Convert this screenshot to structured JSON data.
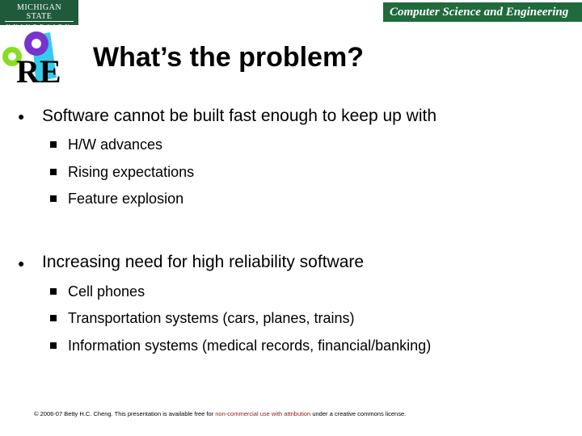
{
  "header": {
    "msu_line1": "MICHIGAN STATE",
    "msu_line2": "UNIVERSITY",
    "department": "Computer Science and Engineering"
  },
  "title": "What’s the problem?",
  "bullets": [
    {
      "text": "Software cannot be built fast enough to keep up with",
      "sub": [
        "H/W advances",
        "Rising expectations",
        "Feature explosion"
      ]
    },
    {
      "text": "Increasing need for high reliability software",
      "sub": [
        "Cell phones",
        "Transportation systems (cars, planes, trains)",
        "Information systems (medical records, financial/banking)"
      ]
    }
  ],
  "footer": {
    "pre": "© 2006-07 Betty H.C. Cheng. This presentation is available free for ",
    "highlight": "non-commercial use with attribution",
    "post": " under a creative commons license."
  },
  "colors": {
    "msu_green": "#1f5a3a",
    "cse_green": "#1f6b3c",
    "footer_highlight": "#8b1a1a"
  }
}
